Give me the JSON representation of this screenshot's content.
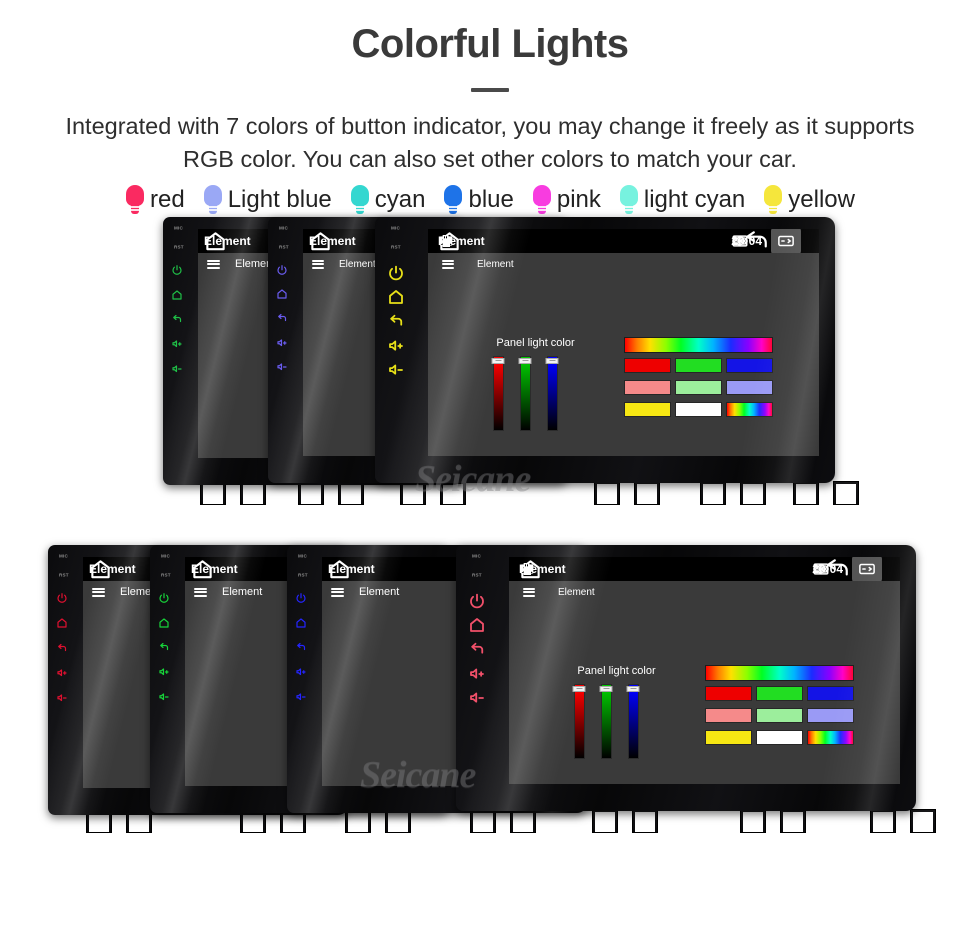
{
  "header": {
    "title": "Colorful Lights",
    "description": "Integrated with 7 colors of button indicator, you may change it freely as it supports RGB color. You can also set other colors to match your car."
  },
  "legend": {
    "items": [
      {
        "label": "red",
        "color": "#fa2a61",
        "icon": "bulb-icon"
      },
      {
        "label": "Light blue",
        "color": "#9aa8f5",
        "icon": "bulb-icon"
      },
      {
        "label": "cyan",
        "color": "#34d7d0",
        "icon": "bulb-icon"
      },
      {
        "label": "blue",
        "color": "#1e73e8",
        "icon": "bulb-icon"
      },
      {
        "label": "pink",
        "color": "#f83ce0",
        "icon": "bulb-icon"
      },
      {
        "label": "light cyan",
        "color": "#77f2df",
        "icon": "bulb-icon"
      },
      {
        "label": "yellow",
        "color": "#f5e63c",
        "icon": "bulb-icon"
      }
    ]
  },
  "device": {
    "side_keys": {
      "mic_label": "MIC",
      "rst_label": "RST",
      "icons": [
        "power-icon",
        "home-icon",
        "back-icon",
        "volume-up-icon",
        "volume-down-icon"
      ]
    },
    "status_bar": {
      "home_icon": "home-icon",
      "title": "Element",
      "icons_left": [
        "image-icon",
        "sdcard-icon"
      ],
      "time": "20:04",
      "icons_right": [
        "screenshot-icon",
        "mute-icon",
        "close-window-icon",
        "recent-apps-icon",
        "back-arrow-icon"
      ]
    },
    "app_bar": {
      "menu_icon": "hamburger-icon",
      "title": "Element"
    },
    "color_panel": {
      "label": "Panel light color",
      "sliders": [
        {
          "name": "red-slider",
          "color": "#ff0000"
        },
        {
          "name": "green-slider",
          "color": "#00c800"
        },
        {
          "name": "blue-slider",
          "color": "#0000ff"
        }
      ],
      "swatches": [
        {
          "name": "swatch-red",
          "color": "#ee0000"
        },
        {
          "name": "swatch-green",
          "color": "#22dd22"
        },
        {
          "name": "swatch-blue",
          "color": "#1414e6"
        },
        {
          "name": "swatch-salmon",
          "color": "#f58a8a"
        },
        {
          "name": "swatch-mint",
          "color": "#9cee9c"
        },
        {
          "name": "swatch-periwinkle",
          "color": "#9a9af5"
        },
        {
          "name": "swatch-yellow",
          "color": "#f7e713"
        },
        {
          "name": "swatch-white",
          "color": "#ffffff"
        },
        {
          "name": "swatch-rainbow",
          "color": "rainbow"
        }
      ]
    }
  },
  "rows": [
    {
      "name": "row-1",
      "units": [
        {
          "name": "unit-green",
          "key_color": "#1fbf47",
          "state": "back"
        },
        {
          "name": "unit-purple",
          "key_color": "#6a5cf0",
          "state": "back"
        },
        {
          "name": "unit-yellow",
          "key_color": "#e8e018",
          "state": "front"
        }
      ]
    },
    {
      "name": "row-2",
      "units": [
        {
          "name": "unit-red",
          "key_color": "#e01030",
          "state": "back"
        },
        {
          "name": "unit-green",
          "key_color": "#17d43a",
          "state": "back"
        },
        {
          "name": "unit-blue",
          "key_color": "#2424ff",
          "state": "back"
        },
        {
          "name": "unit-pink",
          "key_color": "#f2506a",
          "state": "front"
        }
      ]
    }
  ],
  "watermark": {
    "text": "Seicane"
  }
}
